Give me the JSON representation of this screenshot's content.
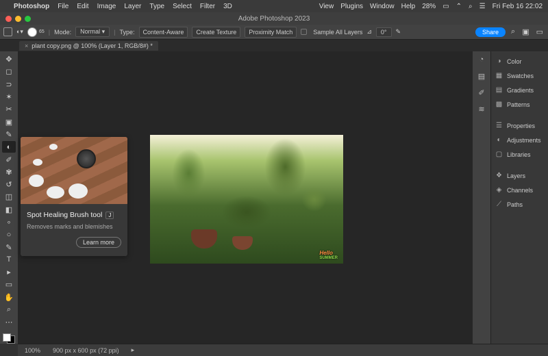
{
  "menubar": {
    "app": "Photoshop",
    "items": [
      "File",
      "Edit",
      "Image",
      "Layer",
      "Type",
      "Select",
      "Filter",
      "3D"
    ],
    "right_items": [
      "View",
      "Plugins",
      "Window",
      "Help"
    ],
    "battery": "28%",
    "clock": "Fri Feb 16  22:02"
  },
  "title": "Adobe Photoshop 2023",
  "optbar": {
    "brush_size": "65",
    "mode_lbl": "Mode:",
    "mode": "Normal",
    "type_lbl": "Type:",
    "btn1": "Content-Aware",
    "btn2": "Create Texture",
    "btn3": "Proximity Match",
    "sample_all": "Sample All Layers",
    "angle": "0°",
    "share": "Share"
  },
  "tab": {
    "name": "plant copy.png @ 100% (Layer 1, RGB/8#) *"
  },
  "tools": [
    {
      "n": "move-tool",
      "g": "✥"
    },
    {
      "n": "marquee-tool",
      "g": "◻"
    },
    {
      "n": "lasso-tool",
      "g": "⊃"
    },
    {
      "n": "magic-wand-tool",
      "g": "✶"
    },
    {
      "n": "crop-tool",
      "g": "✂"
    },
    {
      "n": "frame-tool",
      "g": "▣"
    },
    {
      "n": "eyedropper-tool",
      "g": "✎"
    },
    {
      "n": "spot-heal-tool",
      "g": "◐",
      "sel": true
    },
    {
      "n": "brush-tool",
      "g": "✐"
    },
    {
      "n": "clone-stamp-tool",
      "g": "✾"
    },
    {
      "n": "history-brush-tool",
      "g": "↺"
    },
    {
      "n": "eraser-tool",
      "g": "◫"
    },
    {
      "n": "gradient-tool",
      "g": "◧"
    },
    {
      "n": "blur-tool",
      "g": "∘"
    },
    {
      "n": "dodge-tool",
      "g": "○"
    },
    {
      "n": "pen-tool",
      "g": "✎"
    },
    {
      "n": "type-tool",
      "g": "T"
    },
    {
      "n": "path-select-tool",
      "g": "▸"
    },
    {
      "n": "rectangle-tool",
      "g": "▭"
    },
    {
      "n": "hand-tool",
      "g": "✋"
    },
    {
      "n": "zoom-tool",
      "g": "⌕"
    },
    {
      "n": "edit-toolbar",
      "g": "⋯"
    }
  ],
  "tooltip": {
    "title": "Spot Healing Brush tool",
    "key": "J",
    "desc": "Removes marks and blemishes",
    "learn": "Learn more"
  },
  "image_logo": {
    "l1": "Hello",
    "l2": "SUMMER"
  },
  "gutter": [
    {
      "n": "history-icon",
      "g": "◔"
    },
    {
      "n": "presets-icon",
      "g": "▤"
    },
    {
      "n": "brush-settings-icon",
      "g": "✐"
    },
    {
      "n": "brushes-icon",
      "g": "≋"
    }
  ],
  "panels": [
    {
      "n": "color",
      "lbl": "Color",
      "ic": "◑"
    },
    {
      "n": "swatches",
      "lbl": "Swatches",
      "ic": "▦"
    },
    {
      "n": "gradients",
      "lbl": "Gradients",
      "ic": "▤"
    },
    {
      "n": "patterns",
      "lbl": "Patterns",
      "ic": "▩"
    },
    {
      "sep": true
    },
    {
      "n": "properties",
      "lbl": "Properties",
      "ic": "☰"
    },
    {
      "n": "adjustments",
      "lbl": "Adjustments",
      "ic": "◐"
    },
    {
      "n": "libraries",
      "lbl": "Libraries",
      "ic": "▢"
    },
    {
      "sep": true
    },
    {
      "n": "layers",
      "lbl": "Layers",
      "ic": "❖"
    },
    {
      "n": "channels",
      "lbl": "Channels",
      "ic": "◈"
    },
    {
      "n": "paths",
      "lbl": "Paths",
      "ic": "⟋"
    }
  ],
  "status": {
    "zoom": "100%",
    "dims": "900 px x 600 px (72 ppi)"
  }
}
